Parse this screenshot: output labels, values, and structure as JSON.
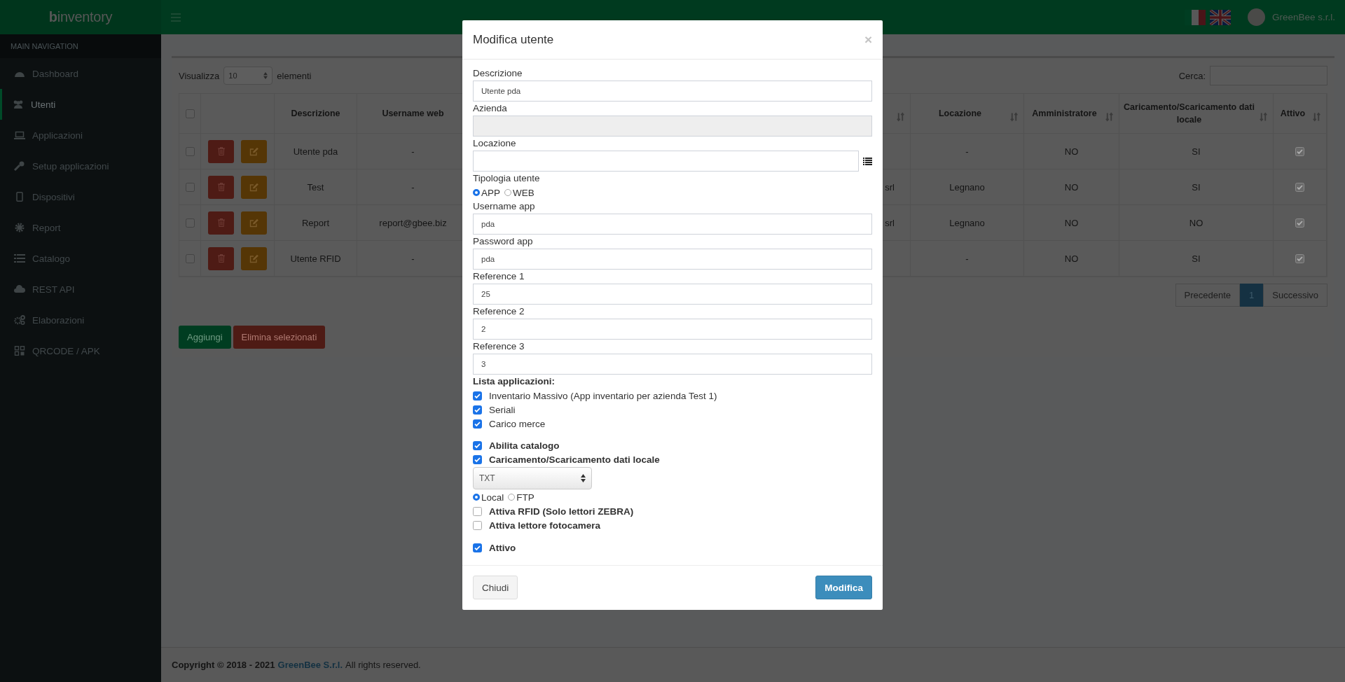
{
  "header": {
    "logo": "**b**inventory",
    "company": "GreenBee s.r.l."
  },
  "sidebar": {
    "heading": "MAIN NAVIGATION",
    "items": [
      {
        "label": "Dashboard",
        "selected": false
      },
      {
        "label": "Utenti",
        "selected": true
      },
      {
        "label": "Applicazioni",
        "selected": false
      },
      {
        "label": "Setup applicazioni",
        "selected": false
      },
      {
        "label": "Dispositivi",
        "selected": false
      },
      {
        "label": "Report",
        "selected": false
      },
      {
        "label": "Catalogo",
        "selected": false
      },
      {
        "label": "REST API",
        "selected": false
      },
      {
        "label": "Elaborazioni",
        "selected": false
      },
      {
        "label": "QRCODE / APK",
        "selected": false
      }
    ]
  },
  "list_controls": {
    "show_label": "Visualizza",
    "page_size": "10",
    "entries_label": "elementi",
    "search_label": "Cerca:"
  },
  "table": {
    "select_all_checked": false,
    "columns": [
      "Descrizione",
      "Username web",
      "Locazione",
      "Amministratore",
      "Caricamento/Scaricamento dati locale",
      "Attivo"
    ],
    "rows": [
      {
        "checked": false,
        "descrizione": "Utente pda",
        "username_web": "-",
        "locazione": "-",
        "amministratore": "NO",
        "caricamento": "SI",
        "attivo": true
      },
      {
        "checked": false,
        "descrizione": "Test",
        "username_web": "-",
        "column_5": "srl",
        "locazione": "Legnano",
        "amministratore": "NO",
        "caricamento": "SI",
        "attivo": true
      },
      {
        "checked": false,
        "descrizione": "Report",
        "username_web": "report@gbee.biz",
        "column_5": "srl",
        "locazione": "Legnano",
        "amministratore": "NO",
        "caricamento": "NO",
        "attivo": true
      },
      {
        "checked": false,
        "descrizione": "Utente RFID",
        "username_web": "-",
        "locazione": "-",
        "amministratore": "NO",
        "caricamento": "SI",
        "attivo": true
      }
    ]
  },
  "pagination": [
    {
      "label": "Precedente",
      "selected": false
    },
    {
      "label": "1",
      "selected": true
    },
    {
      "label": "Successivo",
      "selected": false
    }
  ],
  "actions": {
    "add": "Aggiungi",
    "delete_selected": "Elimina selezionati"
  },
  "modal": {
    "title": "Modifica utente",
    "close": "×",
    "fields": [
      {
        "kind": "text",
        "label": "Descrizione",
        "value": "Utente pda"
      },
      {
        "kind": "readonly",
        "label": "Azienda"
      },
      {
        "kind": "lookup",
        "label": "Locazione"
      },
      {
        "kind": "radio",
        "label": "Tipologia utente",
        "options": [
          {
            "label": "APP",
            "selected": true
          },
          {
            "label": "WEB",
            "selected": false
          }
        ]
      },
      {
        "kind": "text",
        "label": "Username app",
        "value": "pda"
      },
      {
        "kind": "text",
        "label": "Password app",
        "value": "pda"
      },
      {
        "kind": "text",
        "label": "Reference 1",
        "value": "25"
      },
      {
        "kind": "text",
        "label": "Reference 2",
        "value": "2"
      },
      {
        "kind": "text",
        "label": "Reference 3",
        "value": "3"
      }
    ],
    "applications": {
      "title": "Lista applicazioni:",
      "items": [
        {
          "label": "Inventario Massivo (App inventario per azienda Test 1)",
          "checked": true
        },
        {
          "label": "Seriali",
          "checked": true
        },
        {
          "label": "Carico merce",
          "checked": true
        }
      ]
    },
    "options": [
      {
        "kind": "checkbox",
        "label": "Abilita catalogo",
        "checked": true
      },
      {
        "kind": "checkbox",
        "label": "Caricamento/Scaricamento dati locale",
        "checked": true
      },
      {
        "kind": "select",
        "value": "TXT"
      },
      {
        "kind": "radio",
        "options": [
          {
            "label": "Local",
            "selected": true
          },
          {
            "label": "FTP",
            "selected": false
          }
        ]
      },
      {
        "kind": "checkbox",
        "label": "Attiva RFID (Solo lettori ZEBRA)",
        "checked": false
      },
      {
        "kind": "checkbox",
        "label": "Attiva lettore fotocamera",
        "checked": false
      }
    ],
    "active": {
      "label": "Attivo",
      "checked": true
    },
    "buttons": {
      "close": "Chiudi",
      "submit": "Modifica"
    }
  },
  "footer": {
    "copyright": "Copyright © 2018 - 2021",
    "company": "GreenBee S.r.l.",
    "rights": "All rights reserved."
  }
}
